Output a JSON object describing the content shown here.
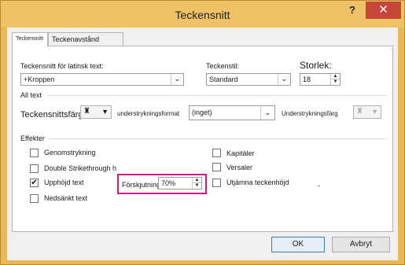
{
  "window": {
    "title": "Teckensnitt",
    "help_glyph": "?",
    "close_glyph": "✕"
  },
  "tabs": [
    {
      "label": "Teckensnitt",
      "active": true
    },
    {
      "label": "Teckenavstånd",
      "active": false
    }
  ],
  "font": {
    "latin_label": "Teckensnitt för latinsk text:",
    "latin_value": "+Kroppen",
    "style_label": "Teckenstil:",
    "style_value": "Standard",
    "size_label": "Storlek:",
    "size_value": "18"
  },
  "all_text": {
    "section_label": "All text",
    "font_color_label": "Teckensnittsfärg",
    "underline_style_label": "understrykningsformat",
    "underline_style_value": "(inget)",
    "underline_color_label": "Understrykningsfärg"
  },
  "effects": {
    "section_label": "Effekter",
    "left": [
      {
        "label": "Genomstrykning",
        "checked": false
      },
      {
        "label": "Double Strikethrough h",
        "checked": false
      },
      {
        "label": "Upphöjd text",
        "checked": true
      },
      {
        "label": "Nedsänkt text",
        "checked": false
      }
    ],
    "right": [
      {
        "label": "Kapitäler",
        "checked": false
      },
      {
        "label": "Versaler",
        "checked": false
      },
      {
        "label": "Utjämna teckenhöjd",
        "checked": false
      }
    ],
    "offset_label": "Förskjutning:",
    "offset_value": "70%",
    "dash": "-"
  },
  "buttons": {
    "ok": "OK",
    "cancel": "Avbryt"
  },
  "colors": {
    "highlight": "#d5158c",
    "title_bar": "#efc268",
    "close": "#c7463a"
  },
  "icons": {
    "color_picker": "paint-bucket-icon",
    "dropdown": "chevron-down-icon",
    "spin": "spin-arrows-icon"
  }
}
